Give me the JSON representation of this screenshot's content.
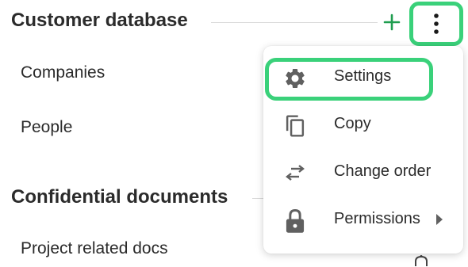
{
  "sidebar": {
    "sections": [
      {
        "title": "Customer database",
        "items": [
          "Companies",
          "People"
        ]
      },
      {
        "title": "Confidential documents",
        "items": [
          "Project related docs"
        ]
      }
    ]
  },
  "header_actions": {
    "add_icon": "plus-icon",
    "more_icon": "more-vertical-icon"
  },
  "menu": {
    "items": [
      {
        "label": "Settings",
        "icon": "gear-icon",
        "highlighted": true
      },
      {
        "label": "Copy",
        "icon": "copy-icon"
      },
      {
        "label": "Change order",
        "icon": "swap-arrows-icon"
      },
      {
        "label": "Permissions",
        "icon": "lock-icon",
        "has_submenu": true
      }
    ]
  },
  "colors": {
    "accent_green": "#3ad17a",
    "plus_green": "#1f9d4f",
    "text": "#2b2b2b",
    "icon_gray": "#606060"
  }
}
